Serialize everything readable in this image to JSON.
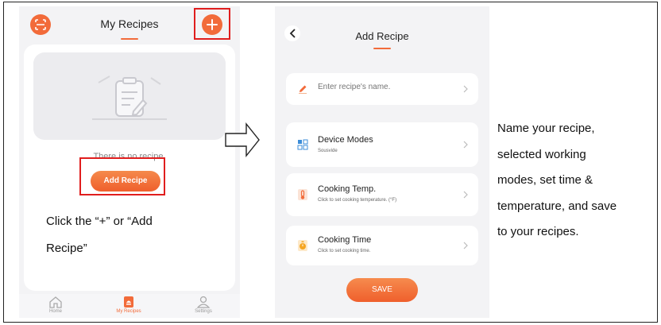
{
  "phone1": {
    "title": "My Recipes",
    "empty_text": "There is no recipe.",
    "add_recipe_label": "Add Recipe",
    "tabs": [
      {
        "label": "Home",
        "icon": "home-icon"
      },
      {
        "label": "My Recipes",
        "icon": "recipe-book-icon"
      },
      {
        "label": "Settings",
        "icon": "settings-icon"
      }
    ]
  },
  "instruction": {
    "line1": "Click the “+” or “Add",
    "line2": "Recipe”"
  },
  "phone2": {
    "title": "Add Recipe",
    "name_placeholder": "Enter recipe's name.",
    "rows": [
      {
        "title": "Device Modes",
        "subtitle": "Sousvide"
      },
      {
        "title": "Cooking Temp.",
        "subtitle": "Click to set cooking temperature. (°F)"
      },
      {
        "title": "Cooking Time",
        "subtitle": "Click to set cooking time."
      }
    ],
    "save_label": "SAVE"
  },
  "description": {
    "lines": [
      "Name your recipe,",
      "selected working",
      "modes, set time &",
      "temperature, and save",
      "to your recipes."
    ]
  },
  "colors": {
    "accent": "#f26b3a",
    "highlight_box": "#e01e1e"
  }
}
